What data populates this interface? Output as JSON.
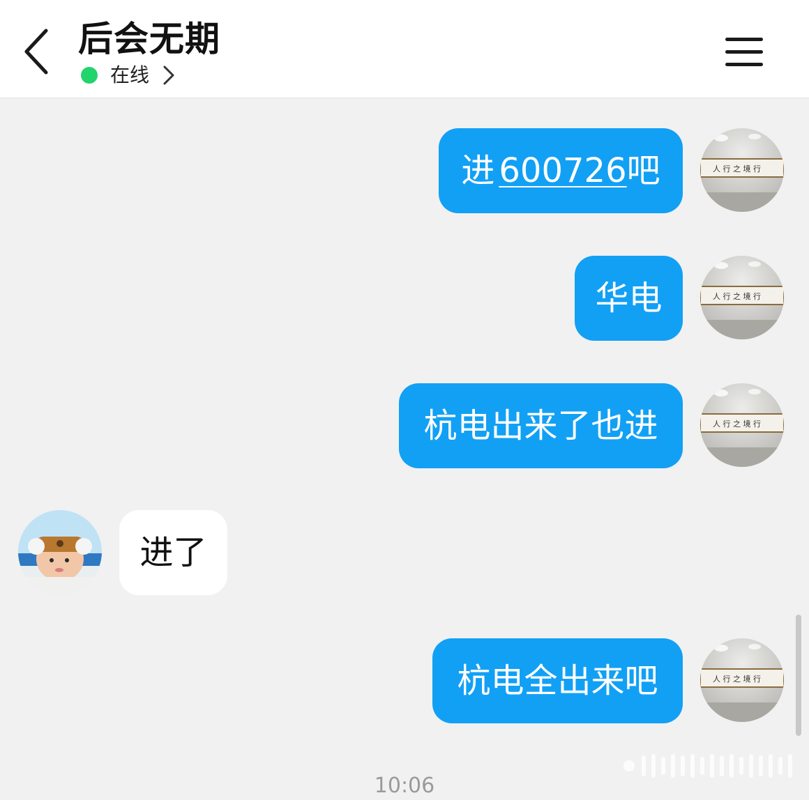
{
  "header": {
    "title": "后会无期",
    "status": "在线",
    "back_icon": "back-chevron-icon",
    "menu_icon": "hamburger-menu-icon",
    "status_color": "#22d46b"
  },
  "messages": [
    {
      "direction": "out",
      "prefix": "进",
      "link": "600726",
      "suffix": "吧"
    },
    {
      "direction": "out",
      "text": "华电"
    },
    {
      "direction": "out",
      "text": "杭电出来了也进"
    },
    {
      "direction": "in",
      "text": "进了"
    },
    {
      "direction": "out",
      "text": "杭电全出来吧"
    }
  ],
  "timestamp": "10:06",
  "colors": {
    "outgoing_bubble": "#12a0f5",
    "incoming_bubble": "#ffffff",
    "background": "#f1f1f1"
  }
}
